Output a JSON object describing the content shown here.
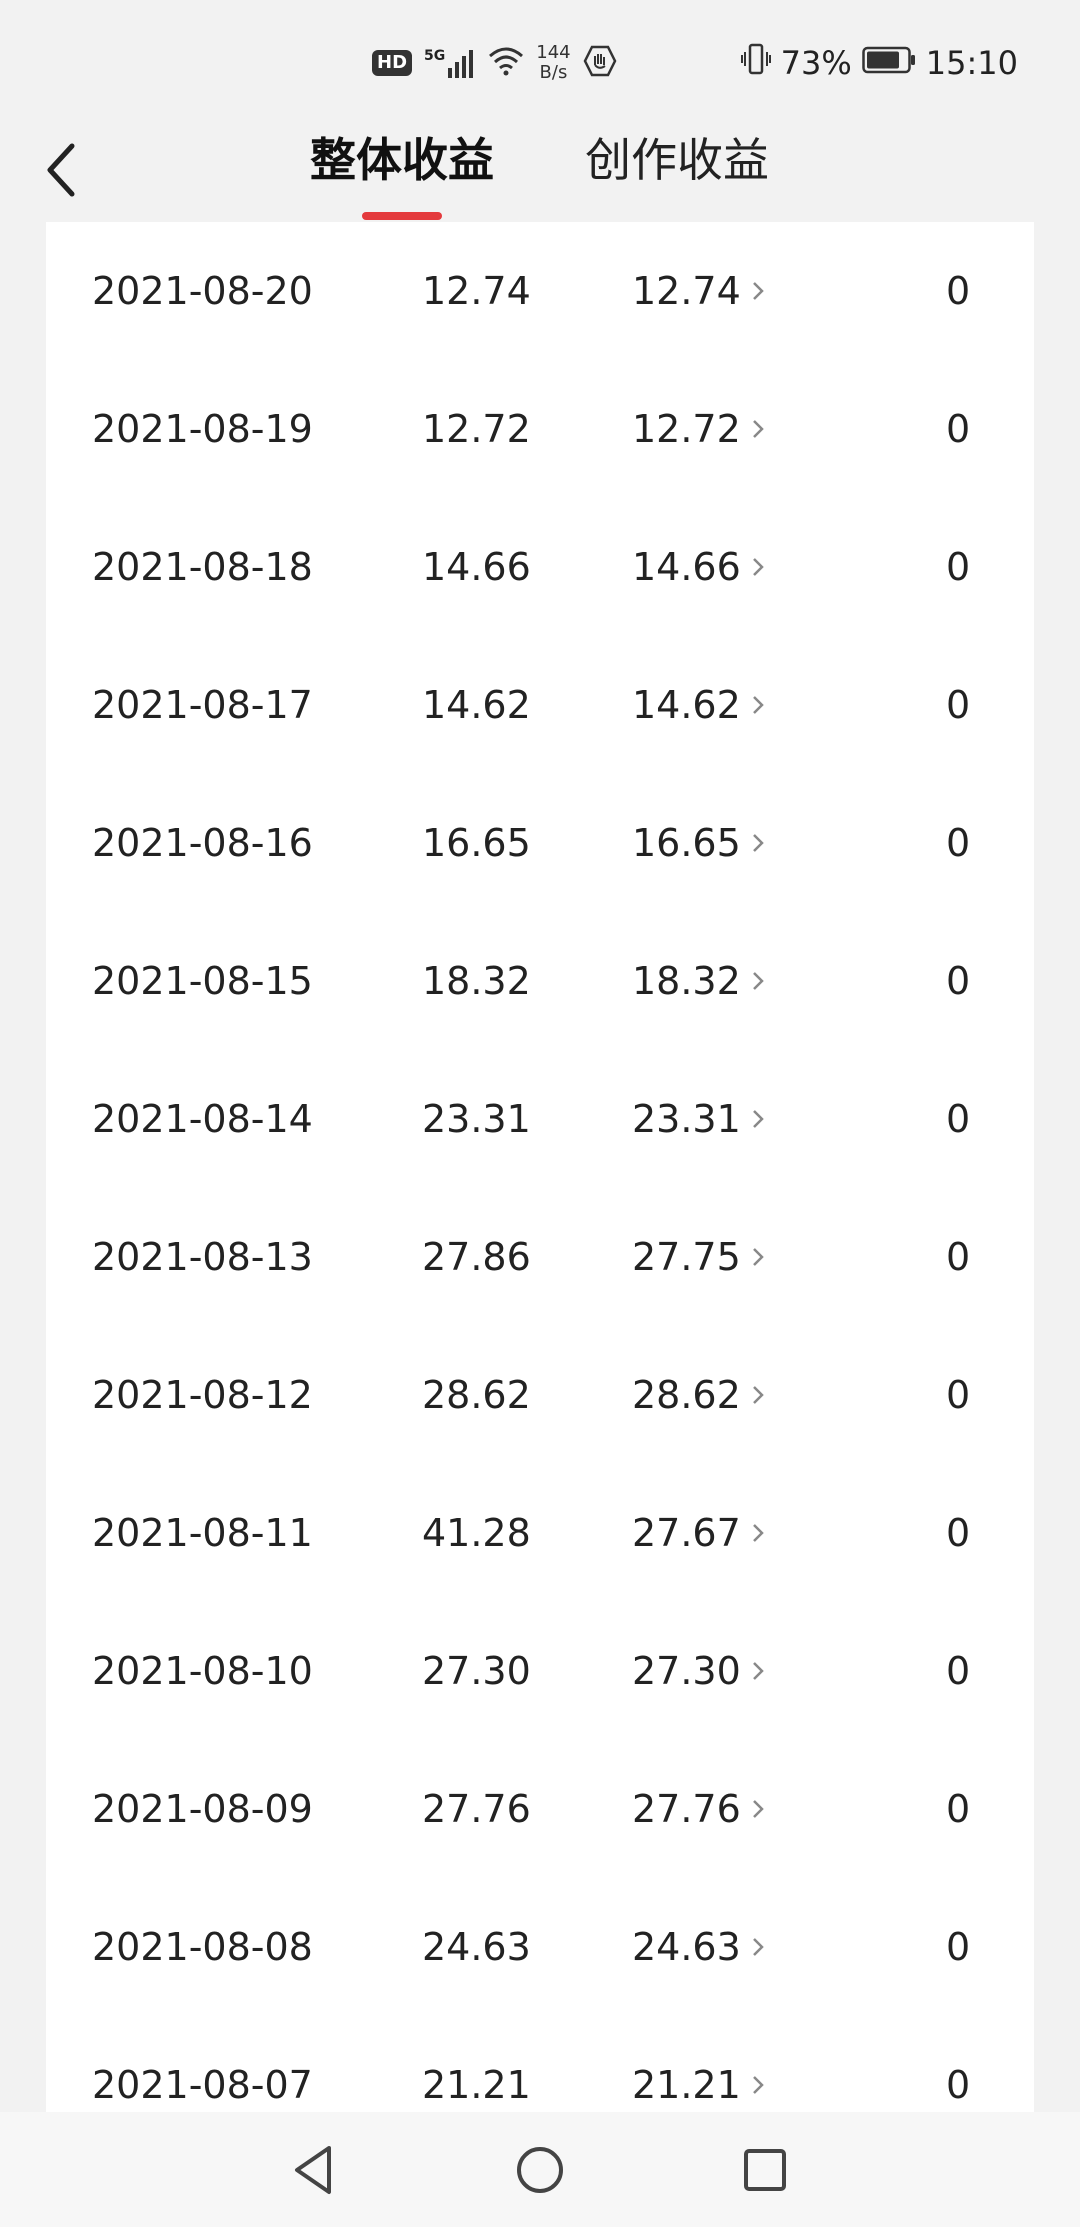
{
  "status_bar": {
    "hd": "HD",
    "network": "5G",
    "speed_value": "144",
    "speed_unit": "B/s",
    "battery": "73%",
    "time": "15:10"
  },
  "header": {
    "tabs": [
      "整体收益",
      "创作收益"
    ],
    "active_tab": 0,
    "accent_color": "#e43a3d"
  },
  "rows": [
    {
      "date": "2021-08-20",
      "total": "12.74",
      "detail": "12.74",
      "other": "0"
    },
    {
      "date": "2021-08-19",
      "total": "12.72",
      "detail": "12.72",
      "other": "0"
    },
    {
      "date": "2021-08-18",
      "total": "14.66",
      "detail": "14.66",
      "other": "0"
    },
    {
      "date": "2021-08-17",
      "total": "14.62",
      "detail": "14.62",
      "other": "0"
    },
    {
      "date": "2021-08-16",
      "total": "16.65",
      "detail": "16.65",
      "other": "0"
    },
    {
      "date": "2021-08-15",
      "total": "18.32",
      "detail": "18.32",
      "other": "0"
    },
    {
      "date": "2021-08-14",
      "total": "23.31",
      "detail": "23.31",
      "other": "0"
    },
    {
      "date": "2021-08-13",
      "total": "27.86",
      "detail": "27.75",
      "other": "0"
    },
    {
      "date": "2021-08-12",
      "total": "28.62",
      "detail": "28.62",
      "other": "0"
    },
    {
      "date": "2021-08-11",
      "total": "41.28",
      "detail": "27.67",
      "other": "0"
    },
    {
      "date": "2021-08-10",
      "total": "27.30",
      "detail": "27.30",
      "other": "0"
    },
    {
      "date": "2021-08-09",
      "total": "27.76",
      "detail": "27.76",
      "other": "0"
    },
    {
      "date": "2021-08-08",
      "total": "24.63",
      "detail": "24.63",
      "other": "0"
    },
    {
      "date": "2021-08-07",
      "total": "21.21",
      "detail": "21.21",
      "other": "0"
    }
  ],
  "icons": {
    "back": "chevron-left-icon",
    "row_arrow": "chevron-right-icon",
    "nav_back": "triangle-back-icon",
    "nav_home": "circle-home-icon",
    "nav_recents": "square-recents-icon"
  }
}
